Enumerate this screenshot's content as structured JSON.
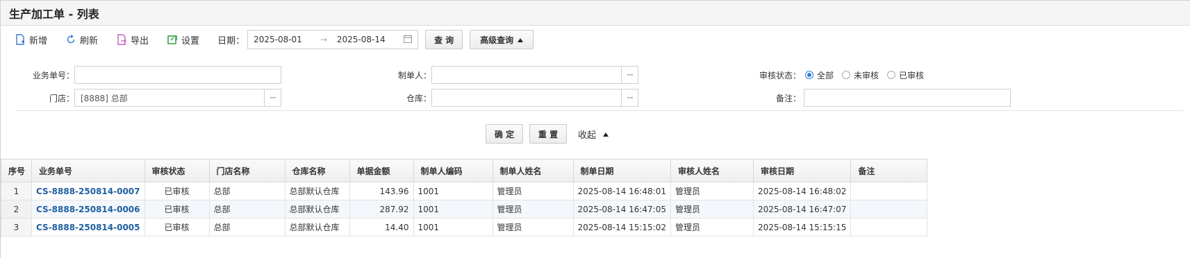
{
  "title": "生产加工单 - 列表",
  "toolbar": {
    "add": "新增",
    "refresh": "刷新",
    "export": "导出",
    "settings": "设置",
    "date_label": "日期：",
    "date_start": "2025-08-01",
    "date_arrow": "→",
    "date_end": "2025-08-14",
    "query": "查 询",
    "advanced": "高级查询"
  },
  "filters": {
    "order_no_label": "业务单号：",
    "order_no_value": "",
    "creator_label": "制单人：",
    "creator_value": "",
    "status_label": "审核状态：",
    "status_options": [
      "全部",
      "未审核",
      "已审核"
    ],
    "store_label": "门店：",
    "store_value": "[8888] 总部",
    "warehouse_label": "仓库：",
    "warehouse_value": "",
    "remark_label": "备注：",
    "remark_value": "",
    "ok": "确 定",
    "reset": "重 置",
    "collapse": "收起"
  },
  "table": {
    "headers": [
      "序号",
      "业务单号",
      "审核状态",
      "门店名称",
      "仓库名称",
      "单据金额",
      "制单人编码",
      "制单人姓名",
      "制单日期",
      "审核人姓名",
      "审核日期",
      "备注"
    ],
    "rows": [
      [
        "1",
        "CS-8888-250814-0007",
        "已审核",
        "总部",
        "总部默认仓库",
        "143.96",
        "1001",
        "管理员",
        "2025-08-14 16:48:01",
        "管理员",
        "2025-08-14 16:48:02",
        ""
      ],
      [
        "2",
        "CS-8888-250814-0006",
        "已审核",
        "总部",
        "总部默认仓库",
        "287.92",
        "1001",
        "管理员",
        "2025-08-14 16:47:05",
        "管理员",
        "2025-08-14 16:47:07",
        ""
      ],
      [
        "3",
        "CS-8888-250814-0005",
        "已审核",
        "总部",
        "总部默认仓库",
        "14.40",
        "1001",
        "管理员",
        "2025-08-14 15:15:02",
        "管理员",
        "2025-08-14 15:15:15",
        ""
      ]
    ]
  },
  "colors": {
    "accent": "#2f7fd8",
    "link": "#1f5fa0",
    "icon_blue": "#3a7bd5",
    "icon_pink": "#c45ec4",
    "icon_green": "#2e9e46"
  }
}
